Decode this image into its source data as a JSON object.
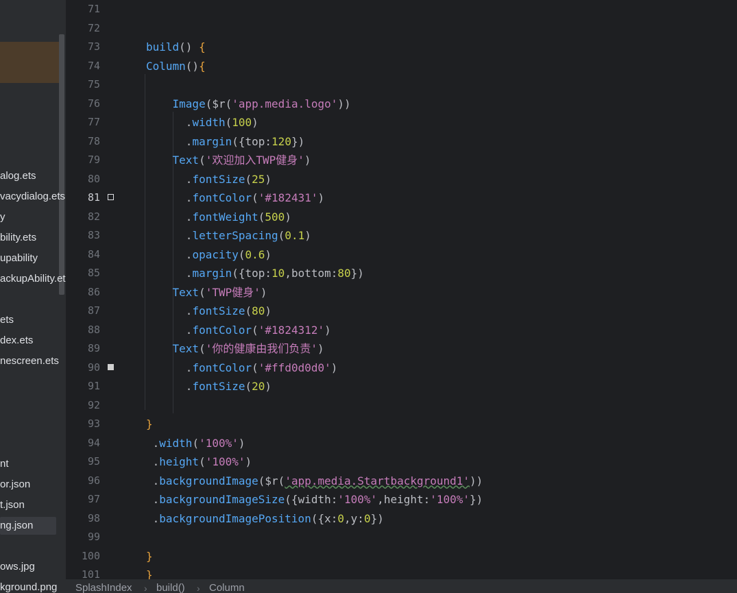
{
  "colors": {
    "editor_bg": "#1e1f22",
    "sidebar_bg": "#2b2d30",
    "fn": "#56a8f5",
    "keyword_brace": "#fbb234",
    "paren_purple": "#d889f0",
    "string": "#c77dbb",
    "number": "#2aacb8",
    "property": "#c8d24c",
    "default": "#bcbec4"
  },
  "sidebar": {
    "files": [
      {
        "label": "alog.ets"
      },
      {
        "label": "vacydialog.ets"
      },
      {
        "label": "y"
      },
      {
        "label": "bility.ets"
      },
      {
        "label": "upability"
      },
      {
        "label": "ackupAbility.ets"
      },
      {
        "label": "ets"
      },
      {
        "label": "dex.ets"
      },
      {
        "label": "nescreen.ets"
      },
      {
        "label": "nt"
      },
      {
        "label": "or.json"
      },
      {
        "label": "t.json"
      },
      {
        "label": "ng.json"
      },
      {
        "label": "ows.jpg"
      },
      {
        "label": "kground.png"
      }
    ]
  },
  "editor": {
    "lines": [
      {
        "num": "71",
        "tokens": []
      },
      {
        "num": "72",
        "tokens": []
      },
      {
        "num": "73",
        "tokens": [
          {
            "t": "build",
            "c": "fn"
          },
          {
            "t": "() ",
            "c": "default"
          },
          {
            "t": "{",
            "c": "brace"
          }
        ]
      },
      {
        "num": "74",
        "tokens": [
          {
            "t": "Column",
            "c": "comp"
          },
          {
            "t": "()",
            "c": "default"
          },
          {
            "t": "{",
            "c": "brace"
          }
        ]
      },
      {
        "num": "75",
        "tokens": []
      },
      {
        "num": "76",
        "tokens": [
          {
            "t": "    Image",
            "c": "comp"
          },
          {
            "t": "(",
            "c": "default"
          },
          {
            "t": "$r",
            "c": "default"
          },
          {
            "t": "(",
            "c": "default"
          },
          {
            "t": "'app.media.logo'",
            "c": "str"
          },
          {
            "t": "))",
            "c": "default"
          }
        ]
      },
      {
        "num": "77",
        "tokens": [
          {
            "t": "      .",
            "c": "default"
          },
          {
            "t": "width",
            "c": "method"
          },
          {
            "t": "(",
            "c": "default"
          },
          {
            "t": "100",
            "c": "num"
          },
          {
            "t": ")",
            "c": "default"
          }
        ]
      },
      {
        "num": "78",
        "tokens": [
          {
            "t": "      .",
            "c": "default"
          },
          {
            "t": "margin",
            "c": "method"
          },
          {
            "t": "({",
            "c": "default"
          },
          {
            "t": "top",
            "c": "default"
          },
          {
            "t": ":",
            "c": "default"
          },
          {
            "t": "120",
            "c": "num"
          },
          {
            "t": "})",
            "c": "default"
          }
        ]
      },
      {
        "num": "79",
        "tokens": [
          {
            "t": "    Text",
            "c": "comp"
          },
          {
            "t": "(",
            "c": "default"
          },
          {
            "t": "'欢迎加入TWP健身'",
            "c": "str"
          },
          {
            "t": ")",
            "c": "default"
          }
        ]
      },
      {
        "num": "80",
        "tokens": [
          {
            "t": "      .",
            "c": "default"
          },
          {
            "t": "fontSize",
            "c": "method"
          },
          {
            "t": "(",
            "c": "default"
          },
          {
            "t": "25",
            "c": "num"
          },
          {
            "t": ")",
            "c": "default"
          }
        ]
      },
      {
        "num": "81",
        "tokens": [
          {
            "t": "      .",
            "c": "default"
          },
          {
            "t": "fontColor",
            "c": "method"
          },
          {
            "t": "(",
            "c": "default"
          },
          {
            "t": "'#182431'",
            "c": "str"
          },
          {
            "t": ")",
            "c": "default"
          }
        ]
      },
      {
        "num": "82",
        "tokens": [
          {
            "t": "      .",
            "c": "default"
          },
          {
            "t": "fontWeight",
            "c": "method"
          },
          {
            "t": "(",
            "c": "default"
          },
          {
            "t": "500",
            "c": "num"
          },
          {
            "t": ")",
            "c": "default"
          }
        ]
      },
      {
        "num": "83",
        "tokens": [
          {
            "t": "      .",
            "c": "default"
          },
          {
            "t": "letterSpacing",
            "c": "method"
          },
          {
            "t": "(",
            "c": "default"
          },
          {
            "t": "0.1",
            "c": "num"
          },
          {
            "t": ")",
            "c": "default"
          }
        ]
      },
      {
        "num": "84",
        "tokens": [
          {
            "t": "      .",
            "c": "default"
          },
          {
            "t": "opacity",
            "c": "method"
          },
          {
            "t": "(",
            "c": "default"
          },
          {
            "t": "0.6",
            "c": "num"
          },
          {
            "t": ")",
            "c": "default"
          }
        ]
      },
      {
        "num": "85",
        "tokens": [
          {
            "t": "      .",
            "c": "default"
          },
          {
            "t": "margin",
            "c": "method"
          },
          {
            "t": "({",
            "c": "default"
          },
          {
            "t": "top",
            "c": "default"
          },
          {
            "t": ":",
            "c": "default"
          },
          {
            "t": "10",
            "c": "num"
          },
          {
            "t": ",",
            "c": "default"
          },
          {
            "t": "bottom",
            "c": "default"
          },
          {
            "t": ":",
            "c": "default"
          },
          {
            "t": "80",
            "c": "num"
          },
          {
            "t": "})",
            "c": "default"
          }
        ]
      },
      {
        "num": "86",
        "tokens": [
          {
            "t": "    Text",
            "c": "comp"
          },
          {
            "t": "(",
            "c": "default"
          },
          {
            "t": "'TWP健身'",
            "c": "str"
          },
          {
            "t": ")",
            "c": "default"
          }
        ]
      },
      {
        "num": "87",
        "tokens": [
          {
            "t": "      .",
            "c": "default"
          },
          {
            "t": "fontSize",
            "c": "method"
          },
          {
            "t": "(",
            "c": "default"
          },
          {
            "t": "80",
            "c": "num"
          },
          {
            "t": ")",
            "c": "default"
          }
        ]
      },
      {
        "num": "88",
        "tokens": [
          {
            "t": "      .",
            "c": "default"
          },
          {
            "t": "fontColor",
            "c": "method"
          },
          {
            "t": "(",
            "c": "default"
          },
          {
            "t": "'#1824312'",
            "c": "str"
          },
          {
            "t": ")",
            "c": "default"
          }
        ]
      },
      {
        "num": "89",
        "tokens": [
          {
            "t": "    Text",
            "c": "comp"
          },
          {
            "t": "(",
            "c": "default"
          },
          {
            "t": "'你的健康由我们负责'",
            "c": "str"
          },
          {
            "t": ")",
            "c": "default"
          }
        ]
      },
      {
        "num": "90",
        "tokens": [
          {
            "t": "      .",
            "c": "default"
          },
          {
            "t": "fontColor",
            "c": "method"
          },
          {
            "t": "(",
            "c": "default"
          },
          {
            "t": "'#ffd0d0d0'",
            "c": "str"
          },
          {
            "t": ")",
            "c": "default"
          }
        ]
      },
      {
        "num": "91",
        "tokens": [
          {
            "t": "      .",
            "c": "default"
          },
          {
            "t": "fontSize",
            "c": "method"
          },
          {
            "t": "(",
            "c": "default"
          },
          {
            "t": "20",
            "c": "num"
          },
          {
            "t": ")",
            "c": "default"
          }
        ]
      },
      {
        "num": "92",
        "tokens": []
      },
      {
        "num": "93",
        "tokens": [
          {
            "t": "}",
            "c": "brace"
          }
        ]
      },
      {
        "num": "94",
        "tokens": [
          {
            "t": " .",
            "c": "default"
          },
          {
            "t": "width",
            "c": "method"
          },
          {
            "t": "(",
            "c": "default"
          },
          {
            "t": "'100%'",
            "c": "str"
          },
          {
            "t": ")",
            "c": "default"
          }
        ]
      },
      {
        "num": "95",
        "tokens": [
          {
            "t": " .",
            "c": "default"
          },
          {
            "t": "height",
            "c": "method"
          },
          {
            "t": "(",
            "c": "default"
          },
          {
            "t": "'100%'",
            "c": "str"
          },
          {
            "t": ")",
            "c": "default"
          }
        ]
      },
      {
        "num": "96",
        "tokens": [
          {
            "t": " .",
            "c": "default"
          },
          {
            "t": "backgroundImage",
            "c": "method"
          },
          {
            "t": "(",
            "c": "default"
          },
          {
            "t": "$r",
            "c": "default"
          },
          {
            "t": "(",
            "c": "default"
          },
          {
            "t": "'app.media.Startbackground1'",
            "c": "str"
          },
          {
            "t": "))",
            "c": "default"
          }
        ]
      },
      {
        "num": "97",
        "tokens": [
          {
            "t": " .",
            "c": "default"
          },
          {
            "t": "backgroundImageSize",
            "c": "method"
          },
          {
            "t": "({",
            "c": "default"
          },
          {
            "t": "width",
            "c": "default"
          },
          {
            "t": ":",
            "c": "default"
          },
          {
            "t": "'100%'",
            "c": "str"
          },
          {
            "t": ",",
            "c": "default"
          },
          {
            "t": "height",
            "c": "default"
          },
          {
            "t": ":",
            "c": "default"
          },
          {
            "t": "'100%'",
            "c": "str"
          },
          {
            "t": "})",
            "c": "default"
          }
        ]
      },
      {
        "num": "98",
        "tokens": [
          {
            "t": " .",
            "c": "default"
          },
          {
            "t": "backgroundImagePosition",
            "c": "method"
          },
          {
            "t": "({",
            "c": "default"
          },
          {
            "t": "x",
            "c": "default"
          },
          {
            "t": ":",
            "c": "default"
          },
          {
            "t": "0",
            "c": "num"
          },
          {
            "t": ",",
            "c": "default"
          },
          {
            "t": "y",
            "c": "default"
          },
          {
            "t": ":",
            "c": "default"
          },
          {
            "t": "0",
            "c": "num"
          },
          {
            "t": "})",
            "c": "default"
          }
        ]
      },
      {
        "num": "99",
        "tokens": []
      },
      {
        "num": "100",
        "tokens": [
          {
            "t": "}",
            "c": "brace"
          }
        ]
      },
      {
        "num": "101",
        "tokens": [
          {
            "t": "}",
            "c": "brace"
          }
        ]
      }
    ],
    "active_line": "81",
    "markers": {
      "81": "outline",
      "90": "filled"
    }
  },
  "breadcrumb": {
    "items": [
      "SplashIndex",
      "build()",
      "Column"
    ]
  }
}
